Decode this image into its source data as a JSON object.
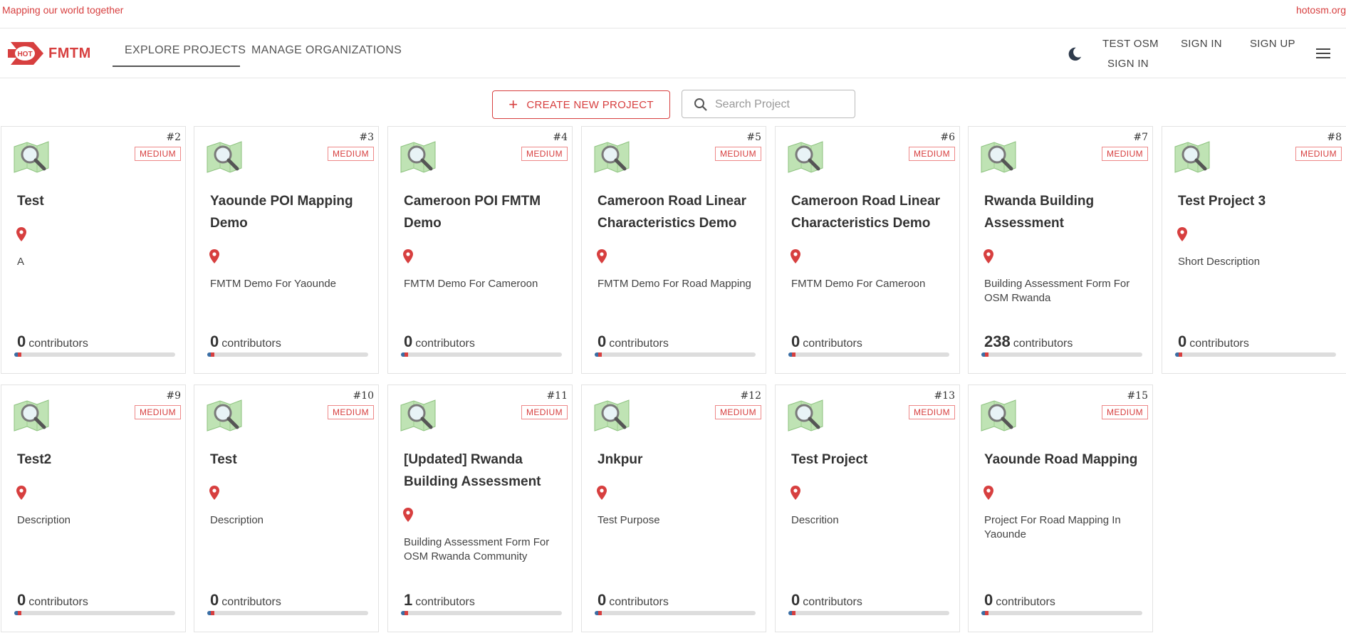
{
  "banner": {
    "tagline": "Mapping our world together",
    "site": "hotosm.org"
  },
  "header": {
    "logo_badge": "HOT",
    "logo_word": "FMTM",
    "tabs": [
      {
        "label": "EXPLORE PROJECTS",
        "active": true
      },
      {
        "label": "MANAGE ORGANIZATIONS",
        "active": false
      }
    ],
    "theme_icon": "moon-icon",
    "user_name": "TEST OSM",
    "user_signin": "SIGN IN",
    "signin": "SIGN IN",
    "signup": "SIGN UP",
    "menu_icon": "hamburger-icon"
  },
  "toolbar": {
    "create_label": "CREATE NEW PROJECT",
    "search_placeholder": "Search Project"
  },
  "colors": {
    "accent": "#d73f3f",
    "text": "#333333",
    "progress_blue": "#3a6ea5",
    "progress_track": "#dddddd"
  },
  "projects": [
    {
      "id": "#2",
      "level": "MEDIUM",
      "title": "Test",
      "description": "A",
      "contributors": "0",
      "contributors_label": "contributors"
    },
    {
      "id": "#3",
      "level": "MEDIUM",
      "title": "Yaounde POI Mapping Demo",
      "description": "FMTM Demo For Yaounde",
      "contributors": "0",
      "contributors_label": "contributors"
    },
    {
      "id": "#4",
      "level": "MEDIUM",
      "title": "Cameroon POI FMTM Demo",
      "description": "FMTM Demo For Cameroon",
      "contributors": "0",
      "contributors_label": "contributors"
    },
    {
      "id": "#5",
      "level": "MEDIUM",
      "title": "Cameroon Road Linear Characteristics Demo",
      "description": "FMTM Demo For Road Mapping",
      "contributors": "0",
      "contributors_label": "contributors"
    },
    {
      "id": "#6",
      "level": "MEDIUM",
      "title": "Cameroon Road Linear Characteristics Demo",
      "description": "FMTM Demo For Cameroon",
      "contributors": "0",
      "contributors_label": "contributors"
    },
    {
      "id": "#7",
      "level": "MEDIUM",
      "title": "Rwanda Building Assessment",
      "description": "Building Assessment Form For OSM Rwanda",
      "contributors": "238",
      "contributors_label": "contributors"
    },
    {
      "id": "#8",
      "level": "MEDIUM",
      "title": "Test Project 3",
      "description": "Short Description",
      "contributors": "0",
      "contributors_label": "contributors"
    },
    {
      "id": "#9",
      "level": "MEDIUM",
      "title": "Test2",
      "description": "Description",
      "contributors": "0",
      "contributors_label": "contributors"
    },
    {
      "id": "#10",
      "level": "MEDIUM",
      "title": "Test",
      "description": "Description",
      "contributors": "0",
      "contributors_label": "contributors"
    },
    {
      "id": "#11",
      "level": "MEDIUM",
      "title": "[Updated] Rwanda Building Assessment",
      "description": "Building Assessment Form For OSM Rwanda Community",
      "contributors": "1",
      "contributors_label": "contributors"
    },
    {
      "id": "#12",
      "level": "MEDIUM",
      "title": "Jnkpur",
      "description": "Test Purpose",
      "contributors": "0",
      "contributors_label": "contributors"
    },
    {
      "id": "#13",
      "level": "MEDIUM",
      "title": "Test Project",
      "description": "Descrition",
      "contributors": "0",
      "contributors_label": "contributors"
    },
    {
      "id": "#15",
      "level": "MEDIUM",
      "title": "Yaounde Road Mapping",
      "description": "Project For Road Mapping In Yaounde",
      "contributors": "0",
      "contributors_label": "contributors"
    }
  ]
}
